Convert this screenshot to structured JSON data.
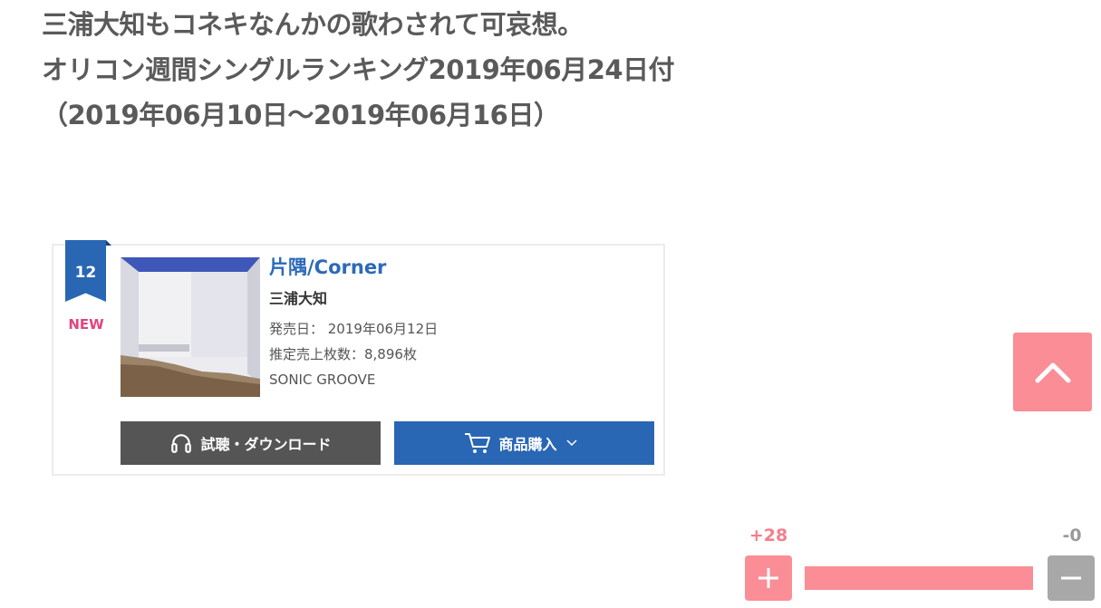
{
  "headline": {
    "line1": "三浦大知もコネキなんかの歌わされて可哀想。",
    "line2": "オリコン週間シングルランキング2019年06月24日付",
    "line3": "（2019年06月10日～2019年06月16日）"
  },
  "ranking_item": {
    "rank": "12",
    "badge": "NEW",
    "title": "片隅/Corner",
    "artist": "三浦大知",
    "release_date": "発売日： 2019年06月12日",
    "estimated_sales": "推定売上枚数：8,896枚",
    "label": "SONIC GROOVE",
    "listen_button": "試聴・ダウンロード",
    "buy_button": "商品購入"
  },
  "votes": {
    "plus_label": "+28",
    "minus_label": "-0",
    "plus_fraction": 1.0
  },
  "colors": {
    "accent_blue": "#2966b3",
    "vote_pink": "#fb8d96",
    "new_pink": "#e0447f"
  },
  "icons": [
    "headphones-icon",
    "cart-icon",
    "chevron-down-icon",
    "chevron-up-icon",
    "plus-icon",
    "minus-icon"
  ]
}
